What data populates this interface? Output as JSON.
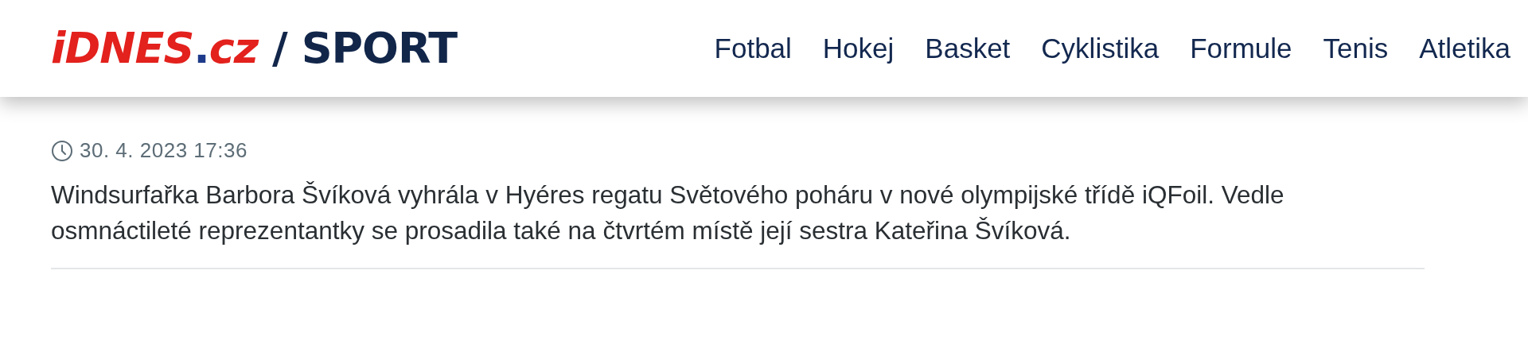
{
  "header": {
    "logo": {
      "brand": "iDNES",
      "dot": ".",
      "tld": "cz",
      "separator": "/",
      "section": "SPORT"
    },
    "nav": [
      "Fotbal",
      "Hokej",
      "Basket",
      "Cyklistika",
      "Formule",
      "Tenis",
      "Atletika"
    ]
  },
  "article": {
    "timestamp": "30. 4. 2023 17:36",
    "perex": "Windsurfařka Barbora Švíková vyhrála v Hyéres regatu Světového poháru v nové olympijské třídě iQFoil. Vedle osmnáctileté reprezentantky se prosadila také na čtvrtém místě její sestra Kateřina Švíková."
  }
}
